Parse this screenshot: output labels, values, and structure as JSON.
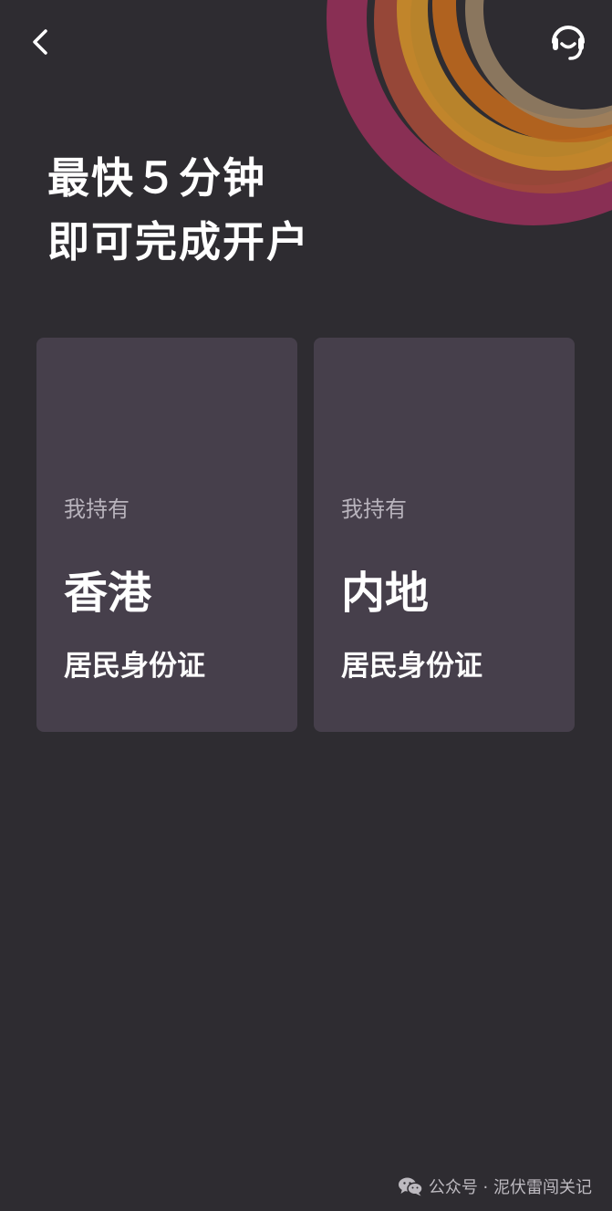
{
  "headline": {
    "line1": "最快５分钟",
    "line2": "即可完成开户"
  },
  "nav": {
    "back_icon": "chevron-left-icon",
    "support_icon": "customer-service-headset-icon"
  },
  "cards": [
    {
      "prefix": "我持有",
      "region": "香港",
      "document": "居民身份证"
    },
    {
      "prefix": "我持有",
      "region": "内地",
      "document": "居民身份证"
    }
  ],
  "watermark": {
    "icon": "wechat-icon",
    "text": "公众号 · 泥伏雷闯关记"
  },
  "colors": {
    "background": "#2e2c31",
    "card": "#463f4b",
    "ring_magenta": "#8e2f56",
    "ring_orange": "#b7651f",
    "ring_gold": "#c48b2a"
  }
}
